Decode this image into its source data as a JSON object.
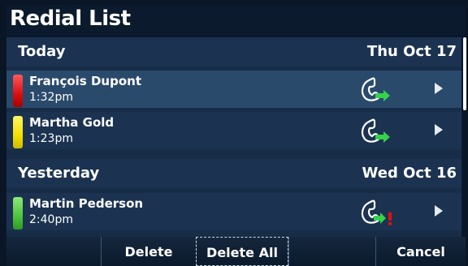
{
  "title": "Redial List",
  "sections": [
    {
      "label": "Today",
      "date": "Thu Oct 17",
      "entries": [
        {
          "name": "François Dupont",
          "time": "1:32pm",
          "color": "#e01818",
          "icon": "outgoing-call-icon",
          "selected": true
        },
        {
          "name": "Martha Gold",
          "time": "1:23pm",
          "color": "#f3e000",
          "icon": "outgoing-call-icon",
          "selected": false
        }
      ]
    },
    {
      "label": "Yesterday",
      "date": "Wed Oct 16",
      "entries": [
        {
          "name": "Martin Pederson",
          "time": "2:40pm",
          "color": "#4cc43c",
          "icon": "outgoing-call-failed-icon",
          "selected": false
        }
      ]
    }
  ],
  "softkeys": [
    "",
    "Delete",
    "Delete All",
    "",
    "Cancel"
  ],
  "colors": {
    "call_arrow": "#35d24a",
    "alert": "#e01010"
  }
}
